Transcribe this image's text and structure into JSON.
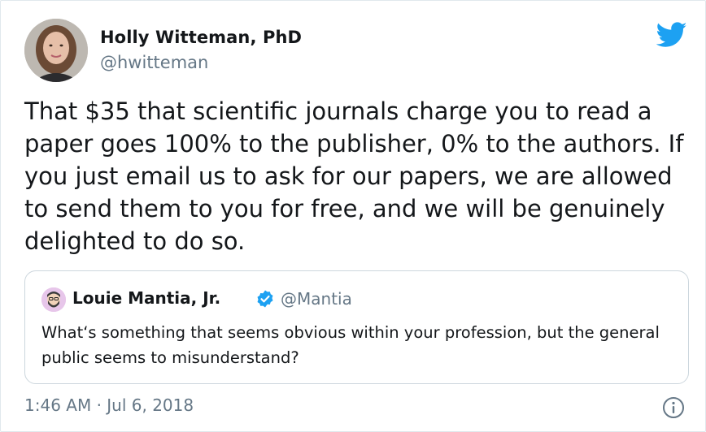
{
  "author": {
    "name": "Holly Witteman, PhD",
    "handle": "@hwitteman"
  },
  "tweet": {
    "text": "That $35 that scientific journals charge you to read a paper goes 100% to the publisher, 0% to the authors. If you just email us to ask for our papers, we are allowed to send them to you for free, and we will be genuinely delighted to do so."
  },
  "quoted_tweet": {
    "name": "Louie Mantia, Jr.",
    "handle": "@Mantia",
    "verified": true,
    "text": "What‘s something that seems obvious within your profession, but the general public seems to misunderstand?"
  },
  "timestamp": "1:46 AM · Jul 6, 2018",
  "icons": {
    "brand": "twitter-bird-icon",
    "verified": "verified-badge-icon",
    "info": "info-icon"
  },
  "colors": {
    "brand_blue": "#1da1f2",
    "secondary_text": "#657786",
    "border": "#ccd6dd"
  }
}
